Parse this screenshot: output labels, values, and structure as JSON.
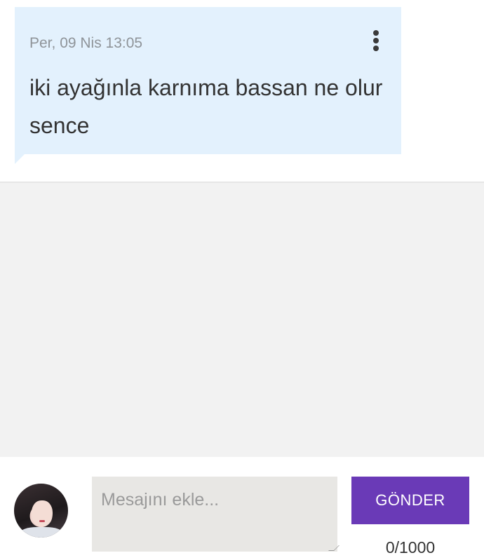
{
  "message": {
    "timestamp": "Per, 09 Nis 13:05",
    "text": "iki ayağınla karnıma bassan ne olur sence",
    "menu_icon": "more-vertical-icon"
  },
  "composer": {
    "avatar_icon": "user-avatar",
    "placeholder": "Mesajını ekle...",
    "value": "",
    "send_label": "GÖNDER",
    "char_count": "0/1000"
  },
  "colors": {
    "bubble": "#e3f1fd",
    "send_button": "#6a3ab7",
    "input_bg": "#e8e7e4",
    "empty_area": "#f2f2f2"
  }
}
